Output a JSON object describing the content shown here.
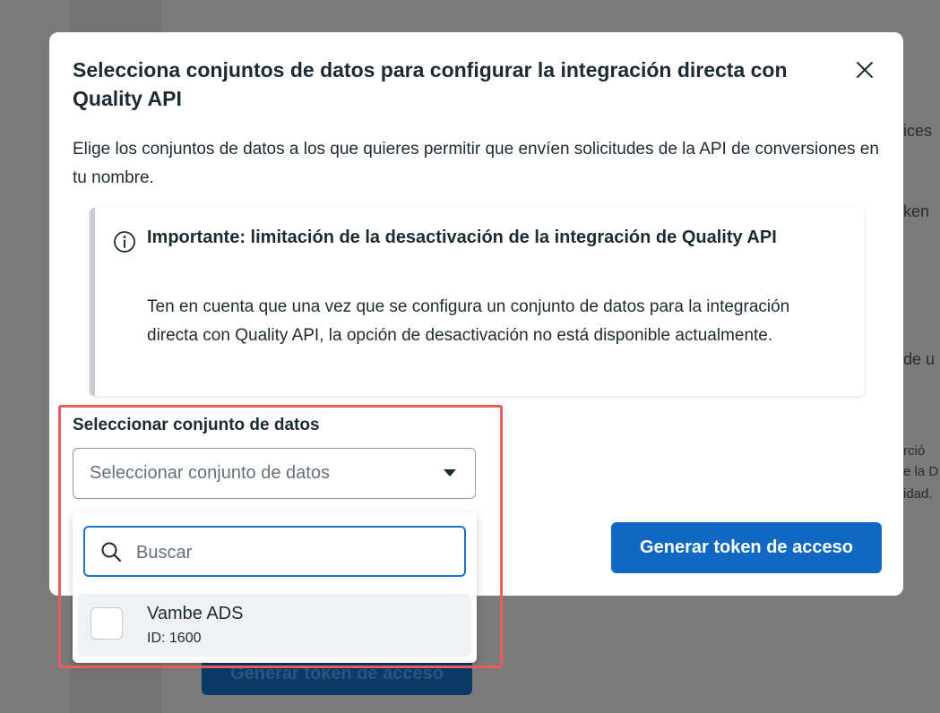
{
  "background": {
    "fragments": [
      "ices",
      "ken",
      "de u",
      "rció",
      "e la D",
      "idad."
    ],
    "button_label": "Generar token de acceso"
  },
  "modal": {
    "title": "Selecciona conjuntos de datos para configurar la integración directa con Quality API",
    "description": "Elige los conjuntos de datos a los que quieres permitir que envíen solicitudes de la API de conversiones en tu nombre.",
    "close_icon": "close-icon",
    "notice": {
      "icon": "info-icon",
      "title": "Importante: limitación de la desactivación de la integración de Quality API",
      "body": "Ten en cuenta que una vez que se configura un conjunto de datos para la integración directa con Quality API, la opción de desactivación no está disponible actualmente."
    },
    "dataset_select": {
      "label": "Seleccionar conjunto de datos",
      "placeholder": "Seleccionar conjunto de datos"
    },
    "primary_button": "Generar token de acceso"
  },
  "dropdown": {
    "search_placeholder": "Buscar",
    "search_value": "",
    "options": [
      {
        "name": "Vambe ADS",
        "id_label": "ID: 1600",
        "checked": false
      }
    ]
  },
  "colors": {
    "primary": "#1168c3",
    "highlight": "#ec5b5e",
    "focus": "#1a73c9"
  }
}
